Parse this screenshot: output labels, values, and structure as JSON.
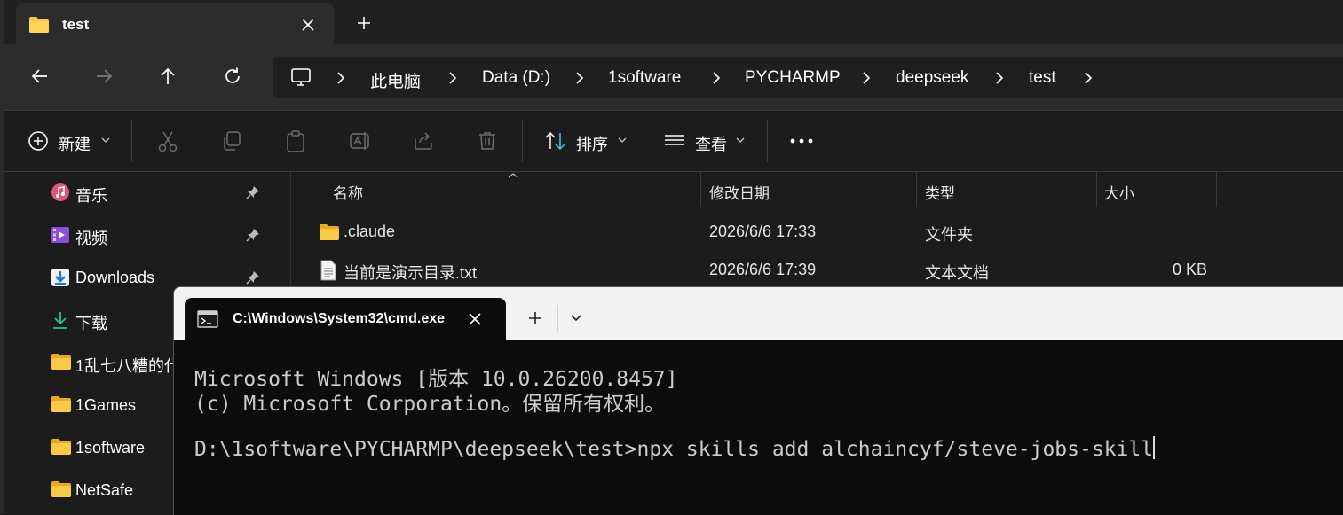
{
  "explorer": {
    "tab_title": "test",
    "breadcrumbs": [
      "此电脑",
      "Data (D:)",
      "1software",
      "PYCHARMP",
      "deepseek",
      "test"
    ],
    "toolbar": {
      "new_label": "新建",
      "sort_label": "排序",
      "view_label": "查看"
    },
    "sidebar": {
      "items": [
        {
          "label": "音乐",
          "icon": "music-icon",
          "pinned": true
        },
        {
          "label": "视频",
          "icon": "video-icon",
          "pinned": true
        },
        {
          "label": "Downloads",
          "icon": "download-icon",
          "pinned": true
        },
        {
          "label": "下载",
          "icon": "download-arrow-icon",
          "pinned": false
        },
        {
          "label": "1乱七八糟的代",
          "icon": "folder-icon",
          "pinned": false
        },
        {
          "label": "1Games",
          "icon": "folder-icon",
          "pinned": false
        },
        {
          "label": "1software",
          "icon": "folder-icon",
          "pinned": false
        },
        {
          "label": "NetSafe",
          "icon": "folder-icon",
          "pinned": false
        }
      ]
    },
    "columns": [
      "名称",
      "修改日期",
      "类型",
      "大小"
    ],
    "files": [
      {
        "name": ".claude",
        "modified": "2026/6/6 17:33",
        "type": "文件夹",
        "size": "",
        "icon": "folder-icon"
      },
      {
        "name": "当前是演示目录.txt",
        "modified": "2026/6/6 17:39",
        "type": "文本文档",
        "size": "0 KB",
        "icon": "text-file-icon"
      }
    ]
  },
  "terminal": {
    "tab_title": "C:\\Windows\\System32\\cmd.exe",
    "lines": [
      "Microsoft Windows [版本 10.0.26200.8457]",
      "(c) Microsoft Corporation。保留所有权利。",
      "",
      "D:\\1software\\PYCHARMP\\deepseek\\test>npx skills add alchaincyf/steve-jobs-skill"
    ]
  },
  "colors": {
    "folder": "#f4c542",
    "accent": "#4cc2ff",
    "terminal_bg": "#0c0c0c",
    "terminal_text": "#cccccc"
  }
}
